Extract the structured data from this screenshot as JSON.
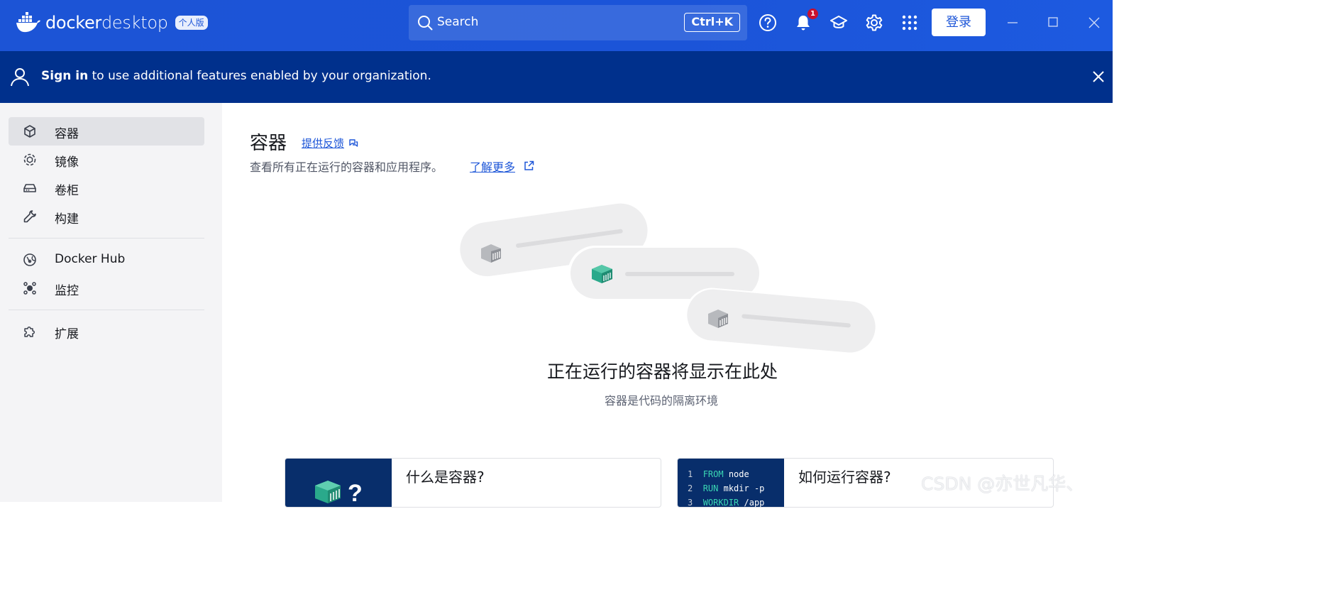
{
  "app": {
    "name_bold": "docker",
    "name_light": "desktop",
    "edition": "个人版"
  },
  "search": {
    "label": "Search",
    "shortcut": "Ctrl+K"
  },
  "toolbar": {
    "notification_count": "1",
    "login_label": "登录"
  },
  "banner": {
    "bold": "Sign in",
    "rest": " to use additional features enabled by your organization."
  },
  "sidebar": {
    "items": [
      {
        "label": "容器",
        "icon": "container-icon",
        "active": true
      },
      {
        "label": "镜像",
        "icon": "image-icon"
      },
      {
        "label": "卷柜",
        "icon": "volume-icon"
      },
      {
        "label": "构建",
        "icon": "build-wrench-icon"
      },
      {
        "label": "Docker Hub",
        "icon": "docker-hub-icon"
      },
      {
        "label": "监控",
        "icon": "monitor-icon"
      },
      {
        "label": "扩展",
        "icon": "extension-puzzle-icon"
      }
    ]
  },
  "main": {
    "title": "容器",
    "feedback": "提供反馈",
    "description": "查看所有正在运行的容器和应用程序。",
    "learn_more": "了解更多",
    "empty_title": "正在运行的容器将显示在此处",
    "empty_subtitle": "容器是代码的隔离环境"
  },
  "cards": [
    {
      "title": "什么是容器?"
    },
    {
      "title": "如何运行容器?",
      "code": [
        {
          "n": "1",
          "kw": "FROM",
          "rest": " node"
        },
        {
          "n": "2",
          "kw": "RUN",
          "rest": " mkdir -p"
        },
        {
          "n": "3",
          "kw": "WORKDIR",
          "rest": " /app"
        }
      ]
    }
  ],
  "watermark": "CSDN @亦世凡华、",
  "colors": {
    "topbar": "#1d56d8",
    "banner": "#00308c",
    "accent": "#1d56d8",
    "container_green": "#2aa98b",
    "sidebar_bg": "#f4f4f6"
  }
}
